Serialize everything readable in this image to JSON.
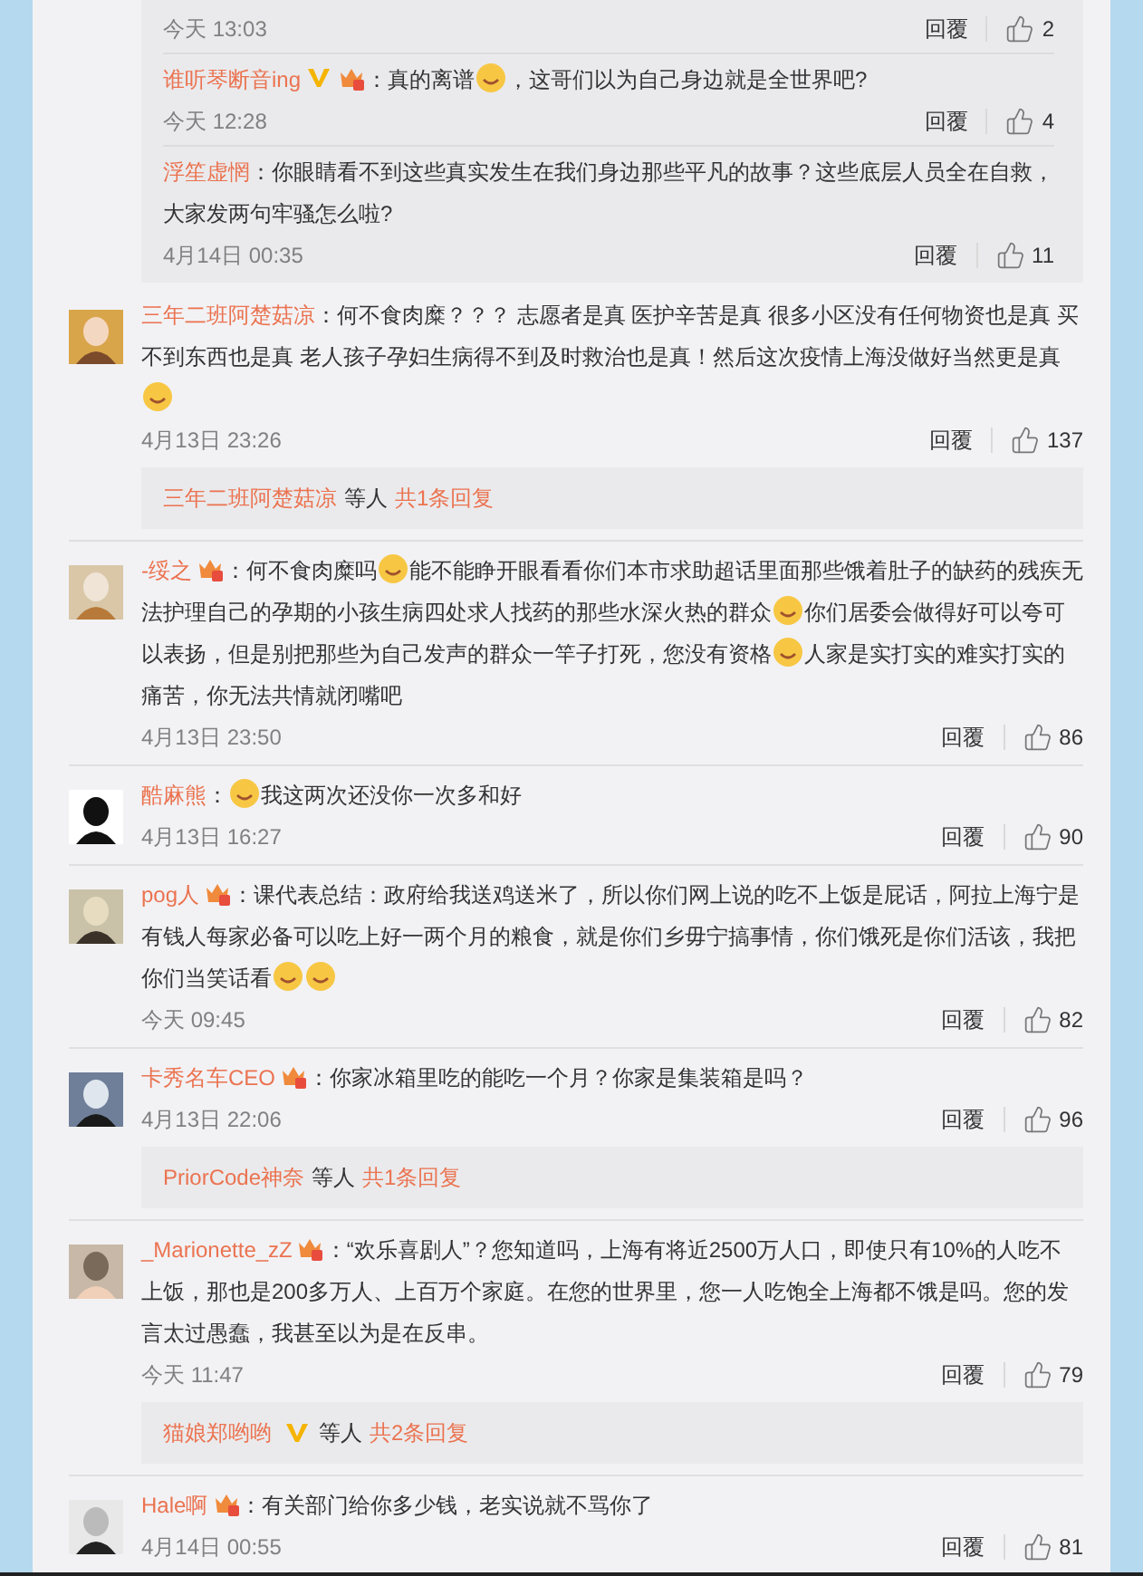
{
  "nested_replies": [
    {
      "time": "今天 13:03",
      "reply": "回覆",
      "likes": "2"
    },
    {
      "name": "谁听琴断音ing",
      "verified": true,
      "badge": true,
      "segments": [
        {
          "kind": "text",
          "text": "：真的离谱"
        },
        {
          "kind": "emoji"
        },
        {
          "kind": "text",
          "text": "，这哥们以为自己身边就是全世界吧?"
        }
      ],
      "time": "今天 12:28",
      "reply": "回覆",
      "likes": "4"
    },
    {
      "name": "浮笙虚惘",
      "verified": false,
      "badge": false,
      "segments": [
        {
          "kind": "text",
          "text": "：你眼睛看不到这些真实发生在我们身边那些平凡的故事？这些底层人员全在自救，大家发两句牢骚怎么啦?"
        }
      ],
      "time": "4月14日 00:35",
      "reply": "回覆",
      "likes": "11"
    }
  ],
  "comments": [
    {
      "name": "三年二班阿楚菇凉",
      "verified": false,
      "badge": false,
      "segments": [
        {
          "kind": "text",
          "text": "：何不食肉糜？？？ 志愿者是真 医护辛苦是真 很多小区没有任何物资也是真 买不到东西也是真 老人孩子孕妇生病得不到及时救治也是真！然后这次疫情上海没做好当然更是真"
        },
        {
          "kind": "emoji"
        }
      ],
      "time": "4月13日 23:26",
      "reply": "回覆",
      "likes": "137",
      "more": {
        "name": "三年二班阿楚菇凉",
        "verified": false,
        "others": "等人",
        "count": "共1条回复"
      }
    },
    {
      "name": "-绥之",
      "verified": false,
      "badge": true,
      "segments": [
        {
          "kind": "text",
          "text": "：何不食肉糜吗"
        },
        {
          "kind": "emoji"
        },
        {
          "kind": "text",
          "text": "能不能睁开眼看看你们本市求助超话里面那些饿着肚子的缺药的残疾无法护理自己的孕期的小孩生病四处求人找药的那些水深火热的群众"
        },
        {
          "kind": "emoji"
        },
        {
          "kind": "text",
          "text": "你们居委会做得好可以夸可以表扬，但是别把那些为自己发声的群众一竿子打死，您没有资格"
        },
        {
          "kind": "emoji"
        },
        {
          "kind": "text",
          "text": "人家是实打实的难实打实的痛苦，你无法共情就闭嘴吧"
        }
      ],
      "time": "4月13日 23:50",
      "reply": "回覆",
      "likes": "86"
    },
    {
      "name": "酷麻熊",
      "verified": false,
      "badge": false,
      "segments": [
        {
          "kind": "text",
          "text": "："
        },
        {
          "kind": "emoji"
        },
        {
          "kind": "text",
          "text": "我这两次还没你一次多和好"
        }
      ],
      "time": "4月13日 16:27",
      "reply": "回覆",
      "likes": "90"
    },
    {
      "name": "pog人",
      "verified": false,
      "badge": true,
      "segments": [
        {
          "kind": "text",
          "text": "：课代表总结：政府给我送鸡送米了，所以你们网上说的吃不上饭是屁话，阿拉上海宁是有钱人每家必备可以吃上好一两个月的粮食，就是你们乡毋宁搞事情，你们饿死是你们活该，我把你们当笑话看"
        },
        {
          "kind": "emoji"
        },
        {
          "kind": "emoji"
        }
      ],
      "time": "今天 09:45",
      "reply": "回覆",
      "likes": "82"
    },
    {
      "name": "卡秀名车CEO",
      "verified": false,
      "badge": true,
      "segments": [
        {
          "kind": "text",
          "text": "：你家冰箱里吃的能吃一个月？你家是集装箱是吗？"
        }
      ],
      "time": "4月13日 22:06",
      "reply": "回覆",
      "likes": "96",
      "more": {
        "name": "PriorCode神奈",
        "verified": false,
        "others": "等人",
        "count": "共1条回复"
      }
    },
    {
      "name": "_Marionette_zZ",
      "verified": false,
      "badge": true,
      "segments": [
        {
          "kind": "text",
          "text": "：“欢乐喜剧人”？您知道吗，上海有将近2500万人口，即使只有10%的人吃不上饭，那也是200多万人、上百万个家庭。在您的世界里，您一人吃饱全上海都不饿是吗。您的发言太过愚蠢，我甚至以为是在反串。"
        }
      ],
      "time": "今天 11:47",
      "reply": "回覆",
      "likes": "79",
      "more": {
        "name": "猫娘郑哟哟",
        "verified": true,
        "others": "等人",
        "count": "共2条回复"
      }
    },
    {
      "name": "Hale啊",
      "verified": false,
      "badge": true,
      "segments": [
        {
          "kind": "text",
          "text": "：有关部门给你多少钱，老实说就不骂你了"
        }
      ],
      "time": "4月14日 00:55",
      "reply": "回覆",
      "likes": "81"
    }
  ]
}
